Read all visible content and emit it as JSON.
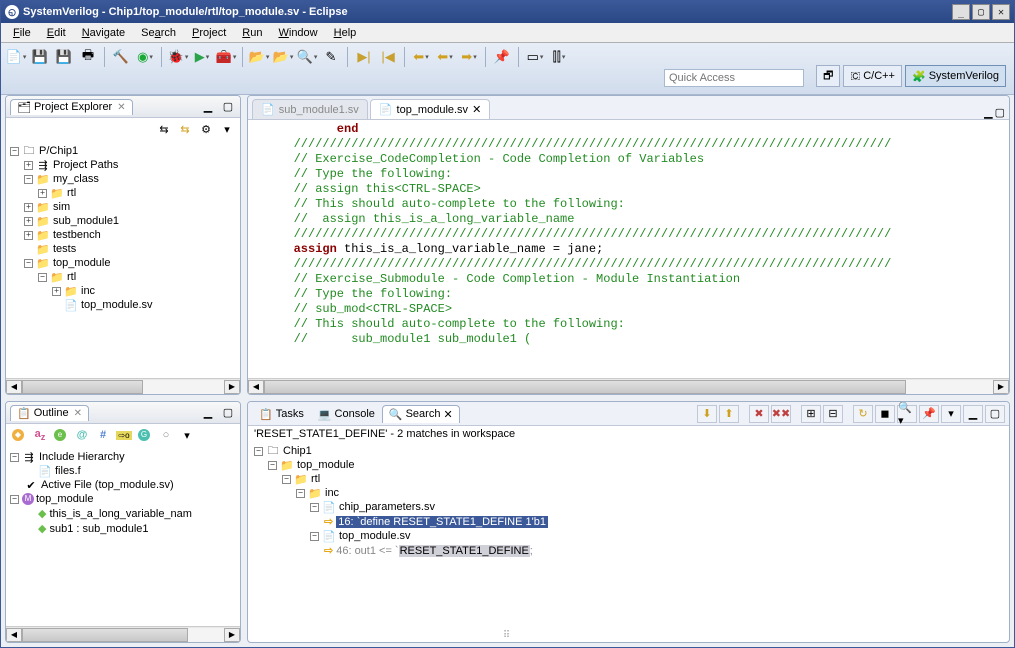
{
  "window": {
    "title": "SystemVerilog - Chip1/top_module/rtl/top_module.sv - Eclipse"
  },
  "menu": {
    "file": "File",
    "edit": "Edit",
    "navigate": "Navigate",
    "search": "Search",
    "project": "Project",
    "run": "Run",
    "window": "Window",
    "help": "Help"
  },
  "toolbar": {
    "quick_access_placeholder": "Quick Access"
  },
  "perspectives": {
    "ccpp": "C/C++",
    "sv": "SystemVerilog"
  },
  "project_explorer": {
    "title": "Project Explorer",
    "root": "P/Chip1",
    "items": {
      "project_paths": "Project Paths",
      "my_class": "my_class",
      "my_class_rtl": "rtl",
      "sim": "sim",
      "sub_module1": "sub_module1",
      "testbench": "testbench",
      "tests": "tests",
      "top_module": "top_module",
      "top_rtl": "rtl",
      "inc": "inc",
      "top_file": "top_module.sv"
    }
  },
  "outline": {
    "title": "Outline",
    "include_hierarchy": "Include Hierarchy",
    "files_f": "files.f",
    "active_file": "Active File (top_module.sv)",
    "top_module": "top_module",
    "var": "this_is_a_long_variable_nam",
    "sub1": "sub1 : sub_module1"
  },
  "editor": {
    "tab_inactive": "sub_module1.sv",
    "tab_active": "top_module.sv",
    "lines": {
      "l0": "         end",
      "l1": "",
      "l2": "   ///////////////////////////////////////////////////////////////////////////////////",
      "l3": "   // Exercise_CodeCompletion - Code Completion of Variables",
      "l4": "   // Type the following:",
      "l5": "   // assign this<CTRL-SPACE>",
      "l6": "   // This should auto-complete to the following:",
      "l7": "   //  assign this_is_a_long_variable_name",
      "l8": "   ///////////////////////////////////////////////////////////////////////////////////",
      "l9a": "   ",
      "l9_kw": "assign",
      "l9_rest": " this_is_a_long_variable_name = jane;",
      "l10": "",
      "l11": "   ///////////////////////////////////////////////////////////////////////////////////",
      "l12": "   // Exercise_Submodule - Code Completion - Module Instantiation",
      "l13": "   // Type the following:",
      "l14": "   // sub_mod<CTRL-SPACE>",
      "l15": "   // This should auto-complete to the following:",
      "l16": "   //      sub_module1 sub_module1 ("
    }
  },
  "bottom": {
    "tasks": "Tasks",
    "console": "Console",
    "search": "Search",
    "summary": "'RESET_STATE1_DEFINE' - 2 matches in workspace",
    "tree": {
      "chip1": "Chip1",
      "top_module": "top_module",
      "rtl": "rtl",
      "inc": "inc",
      "chip_params": "chip_parameters.sv",
      "hit1_pre": "16:  `define ",
      "hit1_hl": "RESET_STATE1_DEFINE 1'b1",
      "top_sv": "top_module.sv",
      "hit2_pre": "46: out1 <= `",
      "hit2_hl": "RESET_STATE1_DEFINE",
      "hit2_post": ";"
    }
  }
}
